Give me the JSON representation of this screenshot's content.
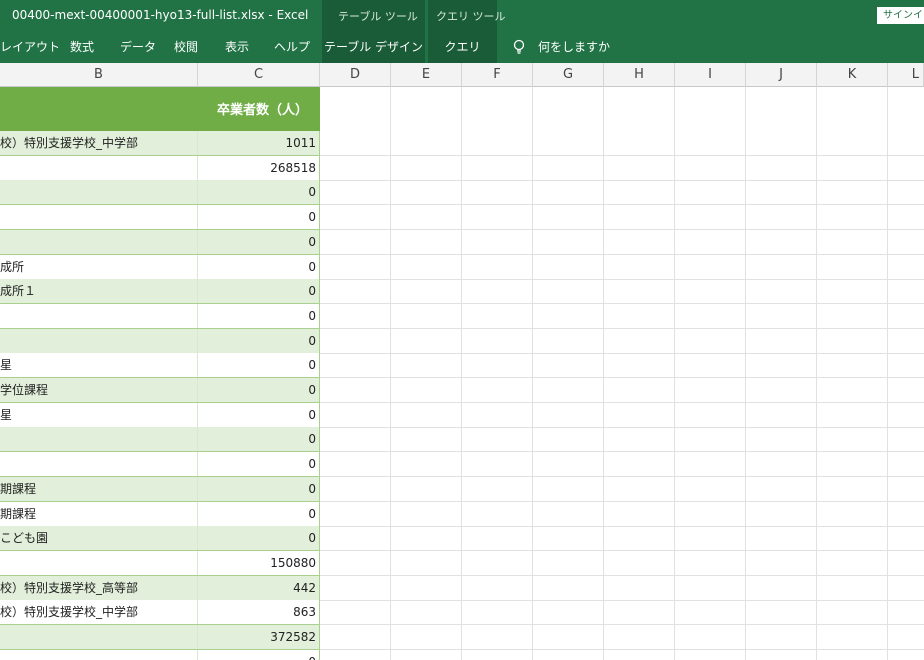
{
  "app": {
    "title": "00400-mext-00400001-hyo13-full-list.xlsx  -  Excel",
    "context_groups": [
      "テーブル ツール",
      "クエリ ツール"
    ],
    "signin_label": "サインイン"
  },
  "ribbon": {
    "tabs": [
      "レイアウト",
      "数式",
      "データ",
      "校閲",
      "表示",
      "ヘルプ"
    ],
    "context_tabs": [
      "テーブル デザイン",
      "クエリ"
    ],
    "tell_me": "何をしますか",
    "tell_me_icon": "lightbulb-icon"
  },
  "columns": [
    "B",
    "C",
    "D",
    "E",
    "F",
    "G",
    "H",
    "I",
    "J",
    "K",
    "L"
  ],
  "table": {
    "header_c": "卒業者数（人）",
    "band_color": "#e2efda",
    "header_color": "#70ad47",
    "rows": [
      {
        "b": "校）特別支援学校_中学部",
        "c": "1011"
      },
      {
        "b": "",
        "c": "268518"
      },
      {
        "b": "",
        "c": "0"
      },
      {
        "b": "",
        "c": "0"
      },
      {
        "b": "",
        "c": "0"
      },
      {
        "b": "成所",
        "c": "0"
      },
      {
        "b": "成所１",
        "c": "0"
      },
      {
        "b": "",
        "c": "0"
      },
      {
        "b": "",
        "c": "0"
      },
      {
        "b": "星",
        "c": "0"
      },
      {
        "b": "学位課程",
        "c": "0"
      },
      {
        "b": "星",
        "c": "0"
      },
      {
        "b": "",
        "c": "0"
      },
      {
        "b": "",
        "c": "0"
      },
      {
        "b": "期課程",
        "c": "0"
      },
      {
        "b": "期課程",
        "c": "0"
      },
      {
        "b": "こども園",
        "c": "0"
      },
      {
        "b": "",
        "c": "150880"
      },
      {
        "b": "校）特別支援学校_高等部",
        "c": "442"
      },
      {
        "b": "校）特別支援学校_中学部",
        "c": "863"
      },
      {
        "b": "",
        "c": "372582"
      },
      {
        "b": "",
        "c": "0"
      }
    ]
  }
}
